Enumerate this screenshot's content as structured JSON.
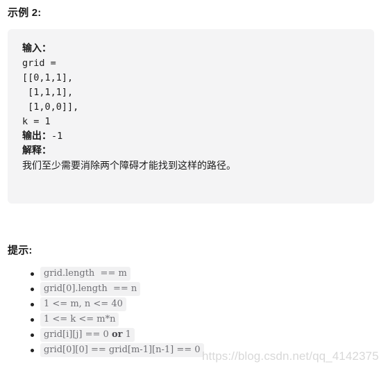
{
  "example": {
    "title": "示例 2:",
    "lines": [
      {
        "type": "label",
        "text": "输入："
      },
      {
        "type": "code",
        "text": "grid ="
      },
      {
        "type": "code",
        "text": "[[0,1,1],"
      },
      {
        "type": "code",
        "text": " [1,1,1],"
      },
      {
        "type": "code",
        "text": " [1,0,0]],"
      },
      {
        "type": "code",
        "text": "k = 1"
      },
      {
        "type": "label_value",
        "label": "输出：",
        "value": "-1"
      },
      {
        "type": "label",
        "text": "解释："
      },
      {
        "type": "text",
        "text": "我们至少需要消除两个障碍才能找到这样的路径。"
      }
    ],
    "input_label": "输入：",
    "grid_assign": "grid =",
    "grid_row_1": "[[0,1,1],",
    "grid_row_2": " [1,1,1],",
    "grid_row_3": " [1,0,0]],",
    "k_assign": "k = 1",
    "output_label": "输出：",
    "output_value": "-1",
    "explain_label": "解释：",
    "explain_text": "我们至少需要消除两个障碍才能找到这样的路径。"
  },
  "hints": {
    "title": "提示:",
    "items": [
      {
        "code_pre": "grid.length  == m",
        "code_bold": "",
        "code_post": ""
      },
      {
        "code_pre": "grid[0].length  == n",
        "code_bold": "",
        "code_post": ""
      },
      {
        "code_pre": "1 <= m, n <= 40",
        "code_bold": "",
        "code_post": ""
      },
      {
        "code_pre": "1 <= k <= m*n",
        "code_bold": "",
        "code_post": ""
      },
      {
        "code_pre": "grid[i][j] == 0 ",
        "code_bold": "or",
        "code_post": " 1"
      },
      {
        "code_pre": "grid[0][0] == grid[m-1][n-1] == 0",
        "code_bold": "",
        "code_post": ""
      }
    ]
  },
  "watermark": {
    "text": "https://blog.csdn.net/qq_41423750"
  },
  "colors": {
    "code_block_bg": "#f4f4f5",
    "inline_code_bg": "#f1f1f2",
    "inline_code_fg": "#6f6f74",
    "body_fg": "#1a1a1a",
    "watermark_fg": "#d8d8d8"
  }
}
